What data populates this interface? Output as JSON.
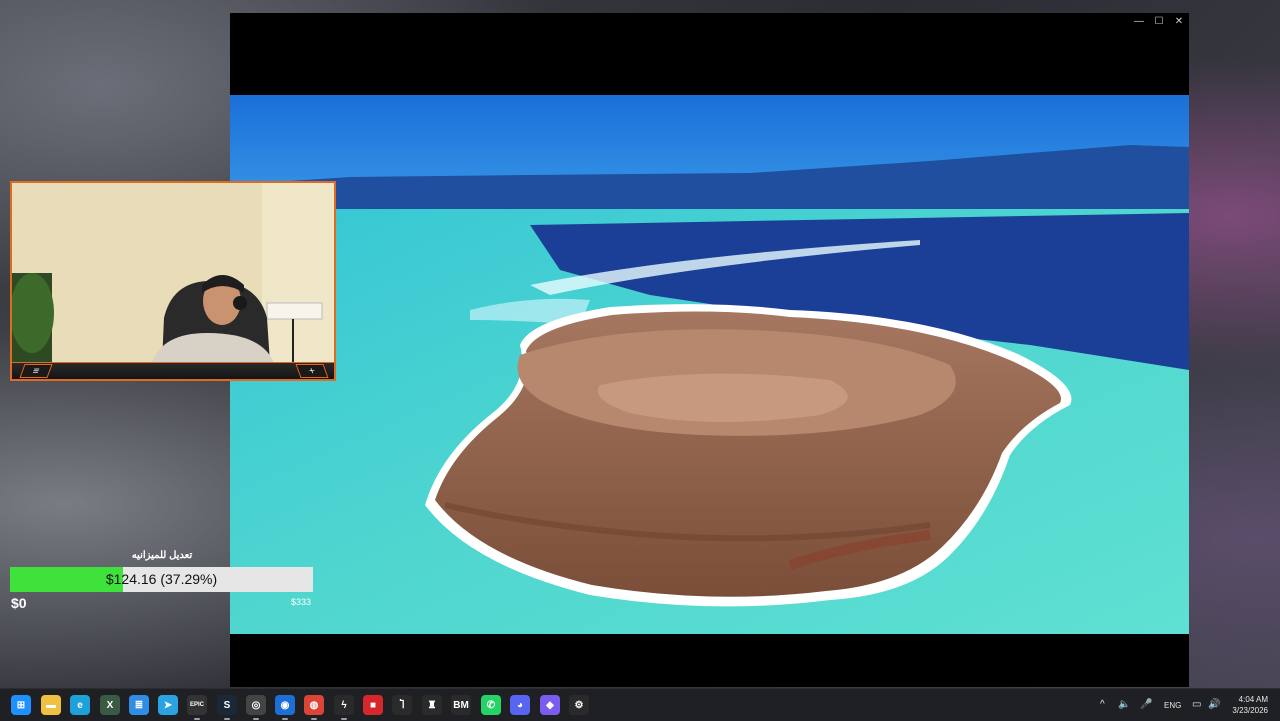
{
  "window": {
    "minimize": "—",
    "maximize": "☐",
    "close": "✕"
  },
  "webcam": {
    "left_button": "≡",
    "right_button": "+"
  },
  "budget": {
    "title": "تعديل للميزانيه",
    "value_label": "$124.16 (37.29%)",
    "progress_fraction": 0.3729,
    "min_label": "$0",
    "max_label": "$333",
    "fill_color": "#3fe23a"
  },
  "taskbar": {
    "icons": [
      {
        "name": "windows-start-icon",
        "glyph": "⊞",
        "color": "#1e90ff"
      },
      {
        "name": "file-explorer-icon",
        "glyph": "▬",
        "color": "#f0c040"
      },
      {
        "name": "edge-icon",
        "glyph": "e",
        "color": "#1ea0d8"
      },
      {
        "name": "excel-icon",
        "glyph": "X",
        "color": "#3a5a44"
      },
      {
        "name": "notepad-icon",
        "glyph": "≣",
        "color": "#2f8de4"
      },
      {
        "name": "telegram-icon",
        "glyph": "➤",
        "color": "#2aa3e0"
      },
      {
        "name": "epic-games-icon",
        "glyph": "EPIC",
        "color": "#333"
      },
      {
        "name": "steam-icon",
        "glyph": "S",
        "color": "#1b2838"
      },
      {
        "name": "vpn-icon",
        "glyph": "◎",
        "color": "#444"
      },
      {
        "name": "app-blue-icon",
        "glyph": "◉",
        "color": "#1d6fd6"
      },
      {
        "name": "chrome-icon",
        "glyph": "◍",
        "color": "#db4437"
      },
      {
        "name": "bolt-app-icon",
        "glyph": "ϟ",
        "color": "#2a2a2a"
      },
      {
        "name": "red-app-icon",
        "glyph": "■",
        "color": "#d6282c"
      },
      {
        "name": "game-app-icon",
        "glyph": "Ⴈ",
        "color": "#2a2a2a"
      },
      {
        "name": "torch-icon",
        "glyph": "♜",
        "color": "#2a2a2a"
      },
      {
        "name": "bm-app-icon",
        "glyph": "BM",
        "color": "#2a2a2a"
      },
      {
        "name": "whatsapp-icon",
        "glyph": "✆",
        "color": "#25d366"
      },
      {
        "name": "discord-icon",
        "glyph": "◕",
        "color": "#5865f2"
      },
      {
        "name": "purple-app-icon",
        "glyph": "◆",
        "color": "#7b5cf0"
      },
      {
        "name": "settings-app-icon",
        "glyph": "⚙",
        "color": "#2a2a2a"
      }
    ],
    "tray": {
      "chevron": "^",
      "speaker": "🔈",
      "mic": "🎤",
      "language": "ENG",
      "display": "▭",
      "volume": "🔊"
    },
    "time": "4:04 AM",
    "date": "3/23/2026"
  }
}
